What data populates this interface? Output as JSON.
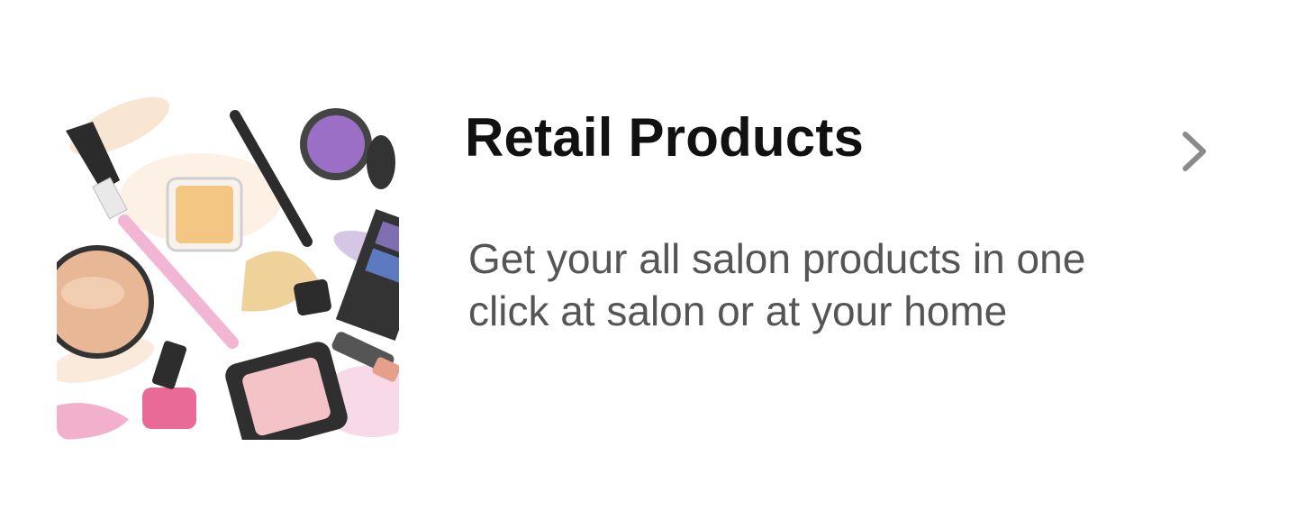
{
  "card": {
    "title": "Retail Products",
    "description": "Get your all salon products in one click at salon or at your home",
    "thumbnail_icon": "makeup-illustration",
    "action_icon": "chevron-right-icon"
  },
  "colors": {
    "title": "#111111",
    "description": "#555555",
    "chevron": "#8a8a8a",
    "background": "#ffffff"
  }
}
